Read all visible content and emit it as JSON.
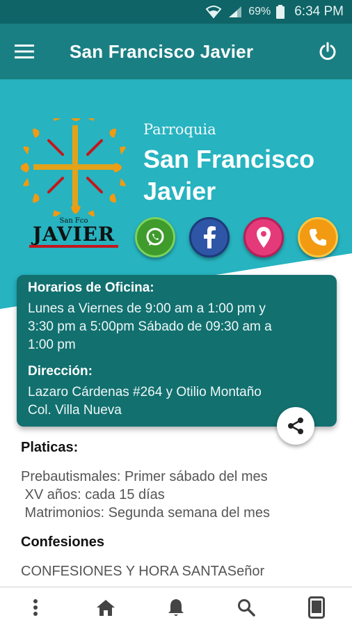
{
  "status_bar": {
    "battery": "69%",
    "time": "6:34 PM"
  },
  "app_bar": {
    "title": "San Francisco Javier",
    "menu_icon": "hamburger-menu-icon",
    "power_icon": "power-icon"
  },
  "hero": {
    "subtitle": "Parroquia",
    "name_line1": "San Francisco",
    "name_line2": "Javier",
    "logo_caption_small": "San Fco",
    "logo_caption": "JAVIER",
    "colors": {
      "background": "#27b3c0",
      "wedge": "#ffffff",
      "sun": "#f29a12",
      "cross": "#e2a21a"
    },
    "social": [
      {
        "name": "whatsapp",
        "icon": "whatsapp-icon"
      },
      {
        "name": "facebook",
        "icon": "facebook-icon"
      },
      {
        "name": "maps",
        "icon": "location-pin-icon"
      },
      {
        "name": "phone",
        "icon": "phone-icon"
      }
    ]
  },
  "info_card": {
    "office_hours_heading": "Horarios de Oficina:",
    "office_hours_line1": "Lunes a Viernes de 9:00 am a 1:00 pm y",
    "office_hours_line2": "3:30 pm a 5:00pm Sábado de 09:30 am a",
    "office_hours_line3": "1:00 pm",
    "address_heading": "Dirección:",
    "address_line1": "Lazaro Cárdenas #264 y Otilio Montaño",
    "address_line2": "Col. Villa Nueva",
    "background": "#12706f"
  },
  "share_icon": "share-icon",
  "sections": {
    "platicas_heading": "Platicas:",
    "platicas_line1": "Prebautismales: Primer sábado del mes",
    "platicas_line2": " XV años: cada 15 días",
    "platicas_line3": " Matrimonios: Segunda semana del mes",
    "confesiones_heading": "Confesiones",
    "confesiones_line1": "CONFESIONES Y HORA SANTASeñor"
  },
  "bottom_nav": [
    {
      "icon": "more-vertical-icon"
    },
    {
      "icon": "home-icon"
    },
    {
      "icon": "bell-icon"
    },
    {
      "icon": "search-icon"
    },
    {
      "icon": "tablet-icon"
    }
  ]
}
